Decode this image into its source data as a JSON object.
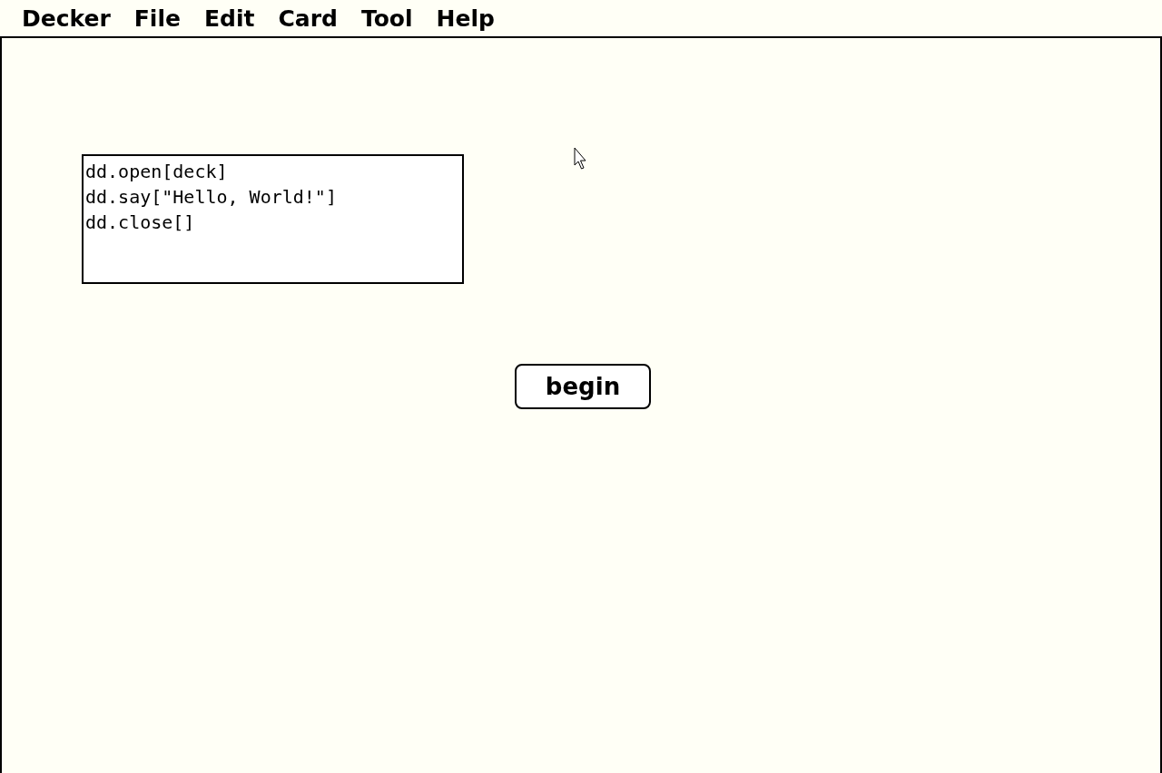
{
  "menu": [
    {
      "label": "Decker"
    },
    {
      "label": "File"
    },
    {
      "label": "Edit"
    },
    {
      "label": "Card"
    },
    {
      "label": "Tool"
    },
    {
      "label": "Help"
    }
  ],
  "field": {
    "value": "dd.open[deck]\ndd.say[\"Hello, World!\"]\ndd.close[]"
  },
  "button": {
    "label": "begin"
  }
}
